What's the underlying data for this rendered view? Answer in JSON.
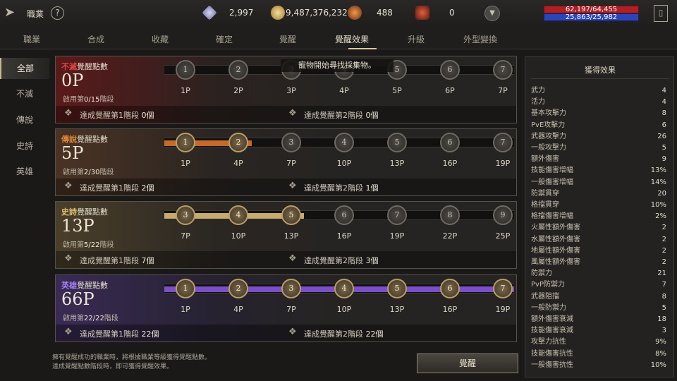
{
  "topbar": {
    "title": "職業",
    "help": "?",
    "diamond": "2,997",
    "gold": "9,487,376,232",
    "orb": "488",
    "crystal": "0",
    "hp": "62,197/64,455",
    "mp": "25,863/25,982"
  },
  "tabs": [
    "職業",
    "合成",
    "收藏",
    "確定",
    "覺醒",
    "覺醒效果",
    "升級",
    "外型變換"
  ],
  "sidebar": [
    "全部",
    "不滅",
    "傳說",
    "史詩",
    "英雄"
  ],
  "toast": "寵物開始尋找採集物。",
  "cards": [
    {
      "label_kw": "不滅",
      "label_rest": "覺醒點數",
      "points": "0P",
      "stage_prefix": "啟用第",
      "stage_num": "0/15",
      "stage_suffix": "階段",
      "nodes": [
        "1",
        "2",
        "3",
        "4",
        "5",
        "6",
        "7"
      ],
      "node_labels": [
        "1P",
        "2P",
        "3P",
        "4P",
        "5P",
        "6P",
        "7P"
      ],
      "active_count": 0,
      "progress": 0,
      "ach1_text": "達成覺醒第1階段",
      "ach1_count": "0個",
      "ach2_text": "達成覺醒第2階段",
      "ach2_count": "0個"
    },
    {
      "label_kw": "傳說",
      "label_rest": "覺醒點數",
      "points": "5P",
      "stage_prefix": "啟用第",
      "stage_num": "2/30",
      "stage_suffix": "階段",
      "nodes": [
        "1",
        "2",
        "3",
        "4",
        "5",
        "6",
        "7"
      ],
      "node_labels": [
        "1P",
        "4P",
        "7P",
        "10P",
        "13P",
        "16P",
        "19P"
      ],
      "active_count": 2,
      "progress": 0.25,
      "ach1_text": "達成覺醒第1階段",
      "ach1_count": "2個",
      "ach2_text": "達成覺醒第2階段",
      "ach2_count": "1個"
    },
    {
      "label_kw": "史詩",
      "label_rest": "覺醒點數",
      "points": "13P",
      "stage_prefix": "啟用第",
      "stage_num": "5/22",
      "stage_suffix": "階段",
      "nodes": [
        "3",
        "4",
        "5",
        "6",
        "7",
        "8",
        "9"
      ],
      "node_labels": [
        "7P",
        "10P",
        "13P",
        "16P",
        "19P",
        "22P",
        "25P"
      ],
      "active_count": 3,
      "progress": 0.4,
      "ach1_text": "達成覺醒第1階段",
      "ach1_count": "7個",
      "ach2_text": "達成覺醒第2階段",
      "ach2_count": "3個"
    },
    {
      "label_kw": "英雄",
      "label_rest": "覺醒點數",
      "points": "66P",
      "stage_prefix": "啟用第",
      "stage_num": "22/22",
      "stage_suffix": "階段",
      "nodes": [
        "1",
        "2",
        "3",
        "4",
        "5",
        "6",
        "7"
      ],
      "node_labels": [
        "1P",
        "4P",
        "7P",
        "10P",
        "13P",
        "16P",
        "19P"
      ],
      "active_count": 7,
      "progress": 1.0,
      "ach1_text": "達成覺醒第1階段",
      "ach1_count": "22個",
      "ach2_text": "達成覺醒第2階段",
      "ach2_count": "22個"
    }
  ],
  "colors": {
    "immortal": "#9b1c1c",
    "legend": "#c46a2a",
    "epic": "#c7ab6d",
    "hero": "#7b4fc8"
  },
  "note": [
    "擁有覺醒成功的職業時，將根據職業等級獲得覺醒點數。",
    "達成覺醒點數階段時，即可獲得覺醒效果。"
  ],
  "awaken_button": "覺醒",
  "panel": {
    "title": "獲得效果",
    "stats": [
      [
        "武力",
        "4"
      ],
      [
        "活力",
        "4"
      ],
      [
        "基本攻擊力",
        "8"
      ],
      [
        "PvE攻擊力",
        "6"
      ],
      [
        "武器攻擊力",
        "26"
      ],
      [
        "一般攻擊力",
        "5"
      ],
      [
        "額外傷害",
        "9"
      ],
      [
        "技能傷害增幅",
        "13%"
      ],
      [
        "一般傷害增幅",
        "14%"
      ],
      [
        "防禦貫穿",
        "20"
      ],
      [
        "格擋貫穿",
        "10%"
      ],
      [
        "格擋傷害增幅",
        "2%"
      ],
      [
        "火屬性額外傷害",
        "2"
      ],
      [
        "水屬性額外傷害",
        "2"
      ],
      [
        "地屬性額外傷害",
        "2"
      ],
      [
        "風屬性額外傷害",
        "2"
      ],
      [
        "防禦力",
        "21"
      ],
      [
        "PvP防禦力",
        "7"
      ],
      [
        "武器阻擋",
        "8"
      ],
      [
        "一般防禦力",
        "5"
      ],
      [
        "額外傷害衰減",
        "18"
      ],
      [
        "技能傷害衰減",
        "3"
      ],
      [
        "攻擊力抗性",
        "9%"
      ],
      [
        "技能傷害抗性",
        "8%"
      ],
      [
        "一般傷害抗性",
        "10%"
      ]
    ]
  }
}
